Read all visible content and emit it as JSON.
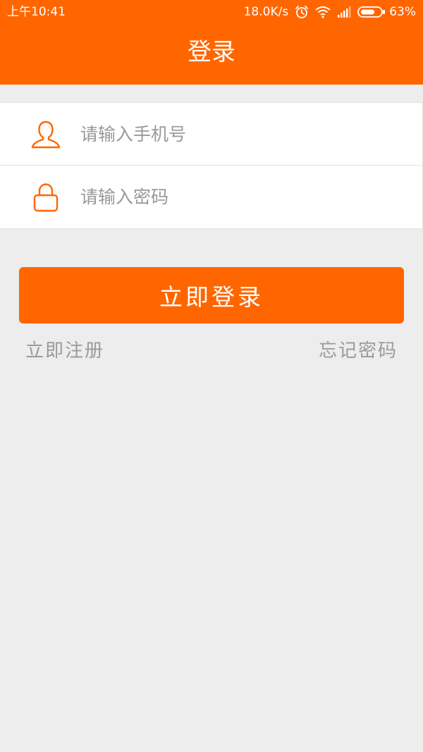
{
  "status_bar": {
    "time": "上午10:41",
    "network_speed": "18.0K/s",
    "battery_percent": "63%",
    "icons": [
      "alarm-icon",
      "wifi-icon",
      "signal-icon",
      "battery-icon"
    ]
  },
  "header": {
    "title": "登录"
  },
  "form": {
    "phone_placeholder": "请输入手机号",
    "password_placeholder": "请输入密码",
    "phone_icon": "user-icon",
    "password_icon": "lock-icon"
  },
  "actions": {
    "login_label": "立即登录",
    "register_label": "立即注册",
    "forgot_label": "忘记密码"
  },
  "colors": {
    "accent": "#FF6600",
    "background": "#EDEDED",
    "link_text": "#9A9A9A"
  }
}
